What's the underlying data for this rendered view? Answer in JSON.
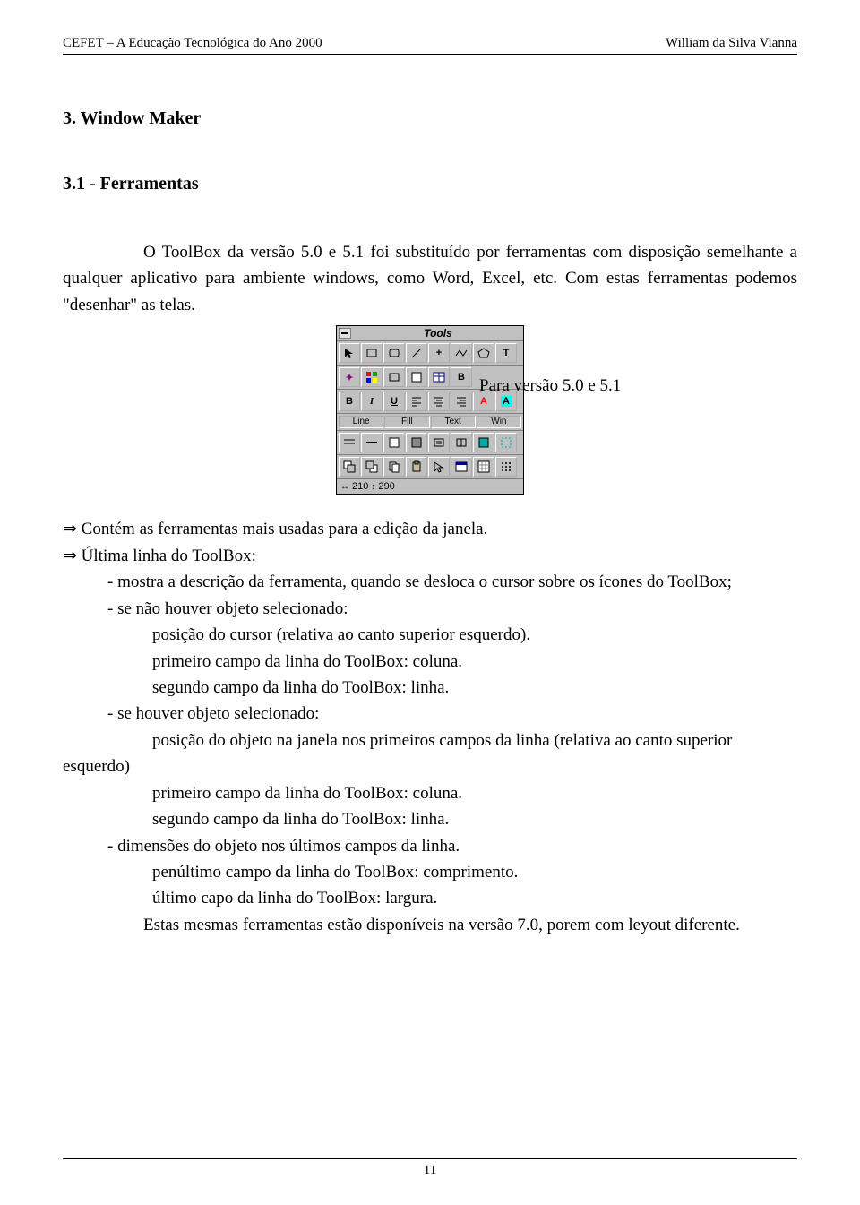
{
  "header": {
    "left": "CEFET – A Educação Tecnológica do Ano 2000",
    "right": "William da Silva Vianna"
  },
  "headings": {
    "main": "3. Window Maker",
    "sub": "3.1 - Ferramentas"
  },
  "intro": "O ToolBox da versão 5.0 e 5.1 foi substituído por ferramentas com disposição semelhante a qualquer aplicativo para ambiente windows, como Word, Excel, etc. Com estas ferramentas podemos \"desenhar\" as telas.",
  "figure_caption": "Para versão 5.0 e 5.1",
  "toolbox": {
    "title": "Tools",
    "section_labels": [
      "Line",
      "Fill",
      "Text",
      "Win"
    ],
    "status": {
      "x": "210",
      "y": "290"
    }
  },
  "body": {
    "p1": "⇒ Contém as ferramentas mais usadas para a edição da janela.",
    "p2": "⇒ Última linha do ToolBox:",
    "p3": "- mostra a descrição da ferramenta, quando se desloca o cursor sobre os ícones do ToolBox;",
    "p4": "- se não houver objeto selecionado:",
    "p5": "posição do cursor (relativa ao canto superior esquerdo).",
    "p6": "primeiro campo da linha do ToolBox: coluna.",
    "p7": "segundo campo da linha do ToolBox: linha.",
    "p8": "- se  houver objeto selecionado:",
    "p9_prefix": "posição do objeto na janela nos primeiros campos da linha (relativa ao canto superior",
    "p9_suffix": "esquerdo)",
    "p10": "primeiro campo da linha do ToolBox: coluna.",
    "p11": "segundo campo da linha do ToolBox: linha.",
    "p12": "- dimensões do objeto nos últimos campos da linha.",
    "p13": "penúltimo campo da linha do ToolBox: comprimento.",
    "p14": "último capo da linha do ToolBox: largura.",
    "p15": "Estas mesmas ferramentas estão disponíveis na versão 7.0, porem com leyout diferente."
  },
  "footer": {
    "page_number": "11"
  }
}
